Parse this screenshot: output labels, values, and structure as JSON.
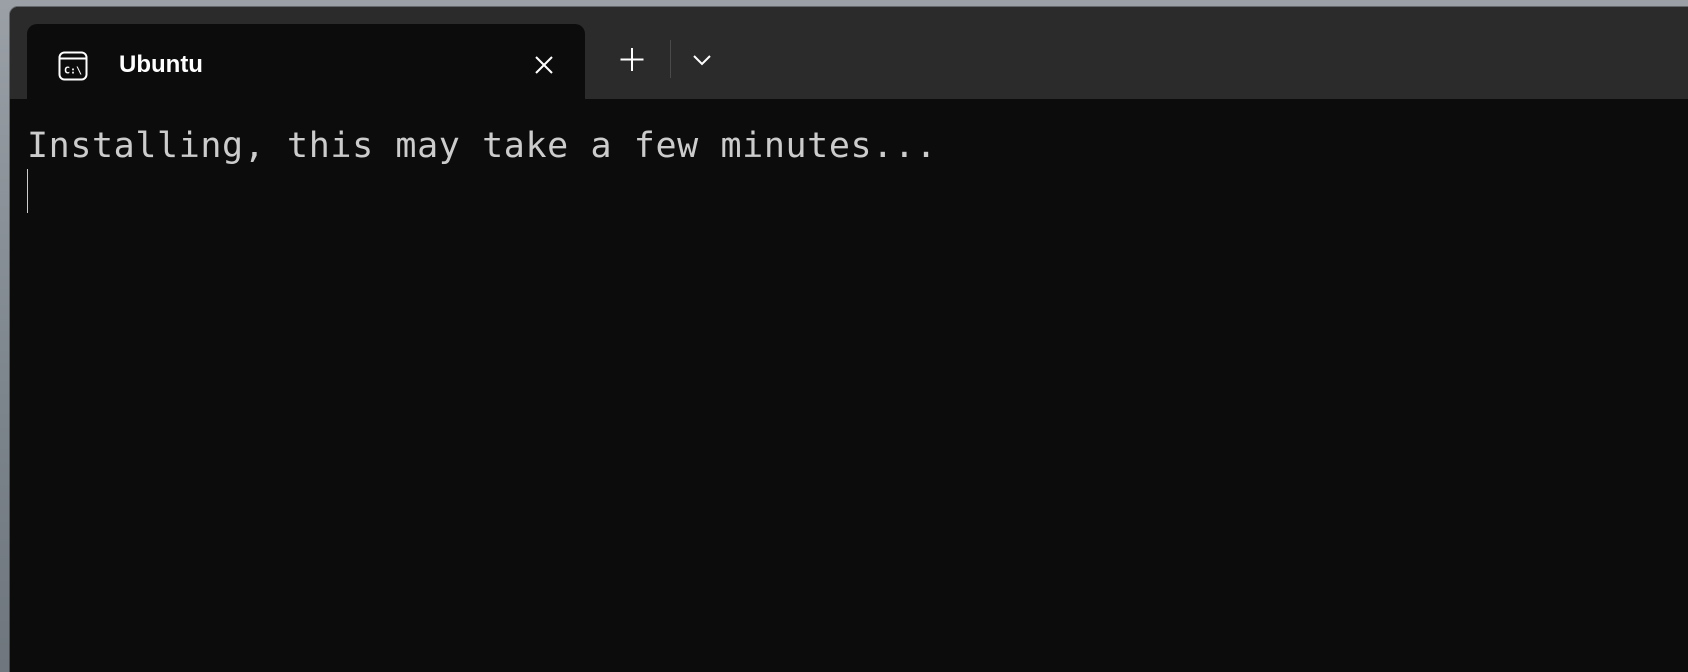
{
  "window": {
    "tab": {
      "title": "Ubuntu",
      "icon": "terminal-icon",
      "close_icon": "close-icon"
    },
    "new_tab_icon": "plus-icon",
    "dropdown_icon": "chevron-down-icon"
  },
  "terminal": {
    "lines": [
      "Installing, this may take a few minutes..."
    ]
  },
  "colors": {
    "tabstrip_bg": "#2b2b2b",
    "terminal_bg": "#0c0c0c",
    "text": "#cccccc",
    "tab_title": "#ffffff"
  }
}
